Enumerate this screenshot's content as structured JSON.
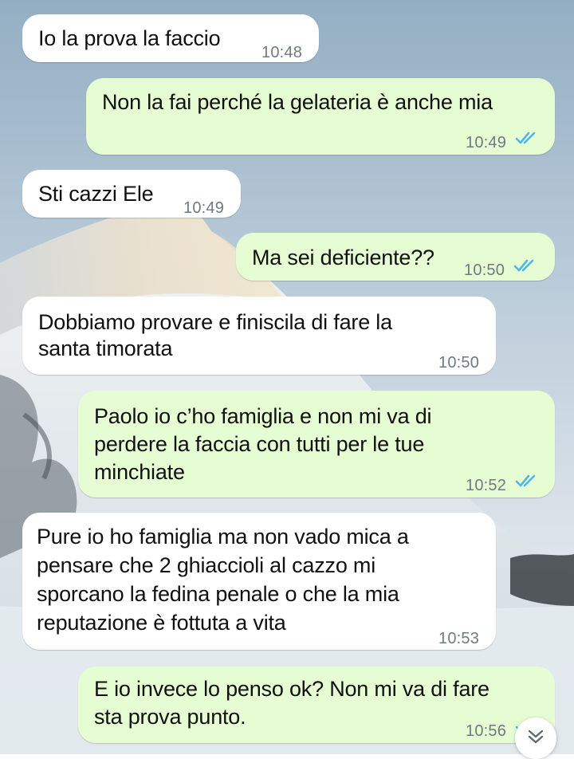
{
  "messages": [
    {
      "dir": "in",
      "text": "Io la prova la faccio",
      "time": "10:48"
    },
    {
      "dir": "out",
      "text": "Non la fai perché la gelateria è anche mia",
      "time": "10:49",
      "read": true
    },
    {
      "dir": "in",
      "text": "Sti cazzi Ele",
      "time": "10:49"
    },
    {
      "dir": "out",
      "text": "Ma sei deficiente??",
      "time": "10:50",
      "read": true
    },
    {
      "dir": "in",
      "lines": [
        "Dobbiamo provare e finiscila di fare la",
        "santa timorata"
      ],
      "time": "10:50"
    },
    {
      "dir": "out",
      "lines": [
        "Paolo io c’ho famiglia e non mi va di",
        "perdere la faccia con tutti per le tue",
        "minchiate"
      ],
      "time": "10:52",
      "read": true
    },
    {
      "dir": "in",
      "lines": [
        "Pure io ho famiglia ma non vado mica a",
        "pensare che 2 ghiaccioli al cazzo mi",
        "sporcano la fedina penale o che la mia",
        "reputazione è fottuta a vita"
      ],
      "time": "10:53"
    },
    {
      "dir": "out",
      "lines": [
        "E io invece lo penso ok? Non mi va di fare",
        "sta prova punto."
      ],
      "time": "10:56",
      "read": true
    }
  ],
  "icons": {
    "read_receipt": "double-check-icon",
    "scroll_down": "double-chevron-down-icon"
  },
  "colors": {
    "incoming_bubble": "#ffffff",
    "outgoing_bubble": "#e6fdd4",
    "read_tick": "#4fb6ec",
    "timestamp": "#6f7a80"
  }
}
